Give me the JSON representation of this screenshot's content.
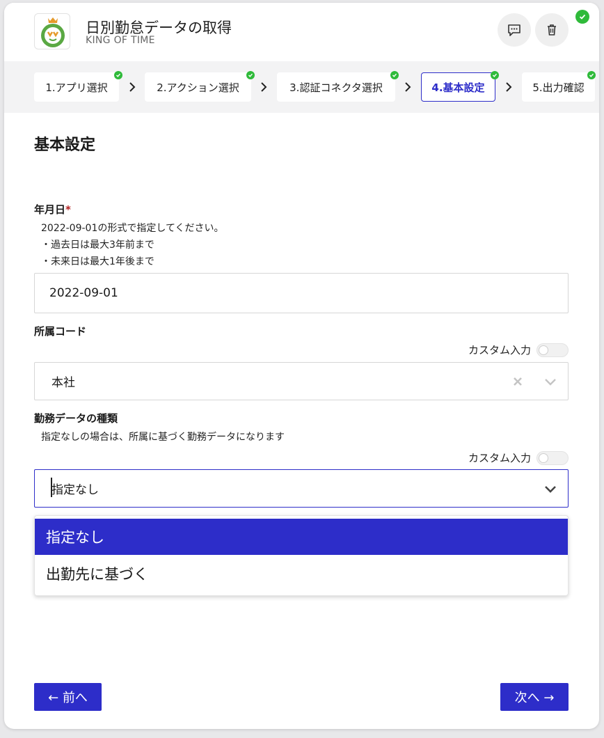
{
  "header": {
    "title": "日別勤怠データの取得",
    "subtitle": "KING OF TIME",
    "logo_icon": "king-of-time-logo",
    "comment_icon": "comment-icon",
    "delete_icon": "trash-icon",
    "status_icon": "check-circle-icon"
  },
  "steps": [
    {
      "label": "1.アプリ選択",
      "done": true
    },
    {
      "label": "2.アクション選択",
      "done": true
    },
    {
      "label": "3.認証コネクタ選択",
      "done": true
    },
    {
      "label": "4.基本設定",
      "done": true,
      "active": true
    },
    {
      "label": "5.出力確認",
      "done": true
    }
  ],
  "section_title": "基本設定",
  "date_field": {
    "label": "年月日",
    "required_mark": "*",
    "help": [
      "2022-09-01の形式で指定してください。",
      "・過去日は最大3年前まで",
      "・未来日は最大1年後まで"
    ],
    "value": "2022-09-01"
  },
  "division_field": {
    "label": "所属コード",
    "custom_input_label": "カスタム入力",
    "custom_input_on": false,
    "value": "本社"
  },
  "work_type_field": {
    "label": "勤務データの種類",
    "help": "指定なしの場合は、所属に基づく勤務データになります",
    "custom_input_label": "カスタム入力",
    "custom_input_on": false,
    "value": "指定なし",
    "options": [
      "指定なし",
      "出勤先に基づく"
    ],
    "selected_index": 0
  },
  "nav": {
    "prev_label": "← 前へ",
    "next_label": "次へ →"
  },
  "colors": {
    "accent": "#2d2dc9",
    "success": "#2fba3a",
    "required": "#b32020"
  }
}
